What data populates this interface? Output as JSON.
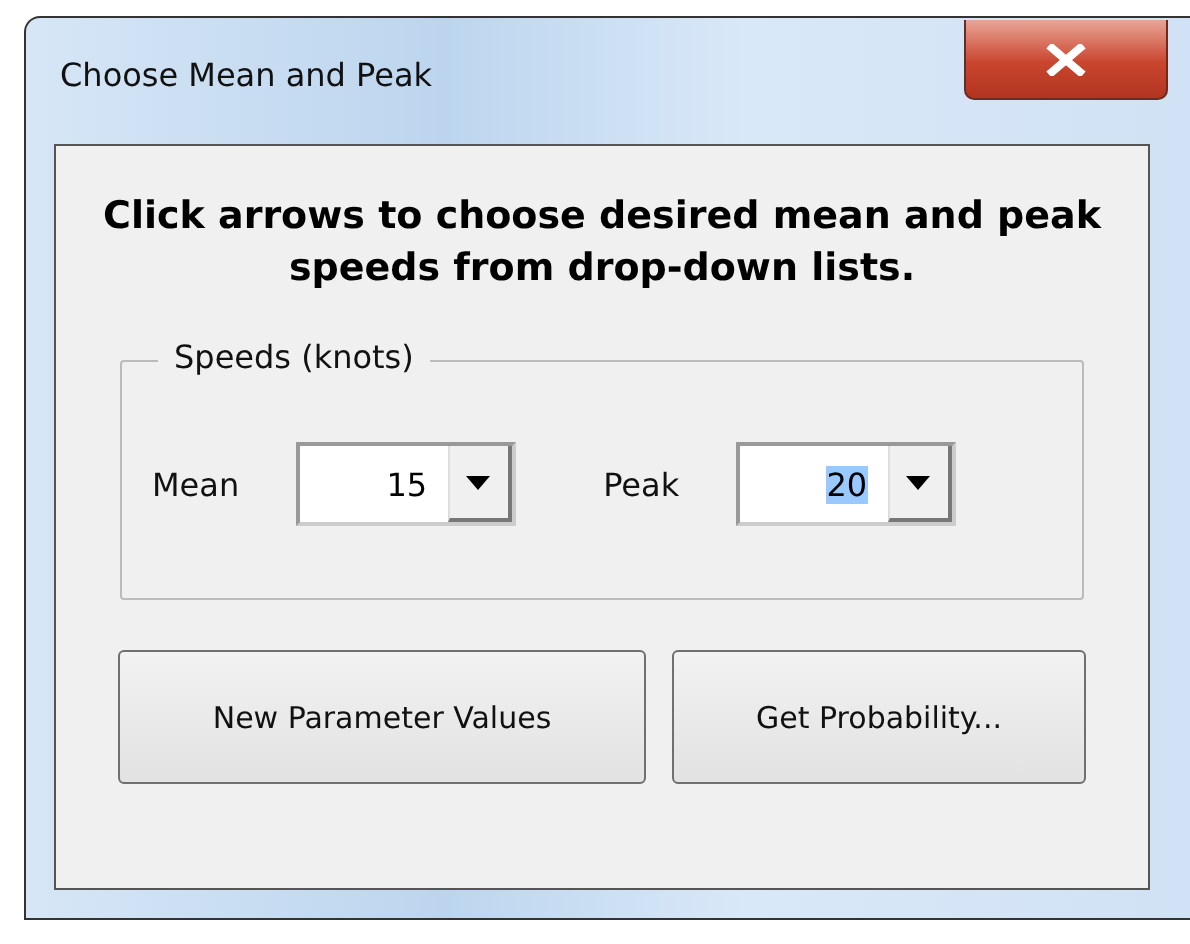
{
  "window": {
    "title": "Choose Mean and Peak"
  },
  "instructions": "Click arrows to choose desired mean and peak speeds from drop-down lists.",
  "group": {
    "title": "Speeds (knots)",
    "fields": [
      {
        "label": "Mean",
        "value": "15",
        "value_selected": false
      },
      {
        "label": "Peak",
        "value": "20",
        "value_selected": true
      }
    ]
  },
  "buttons": [
    "New Parameter Values",
    "Get Probability..."
  ]
}
